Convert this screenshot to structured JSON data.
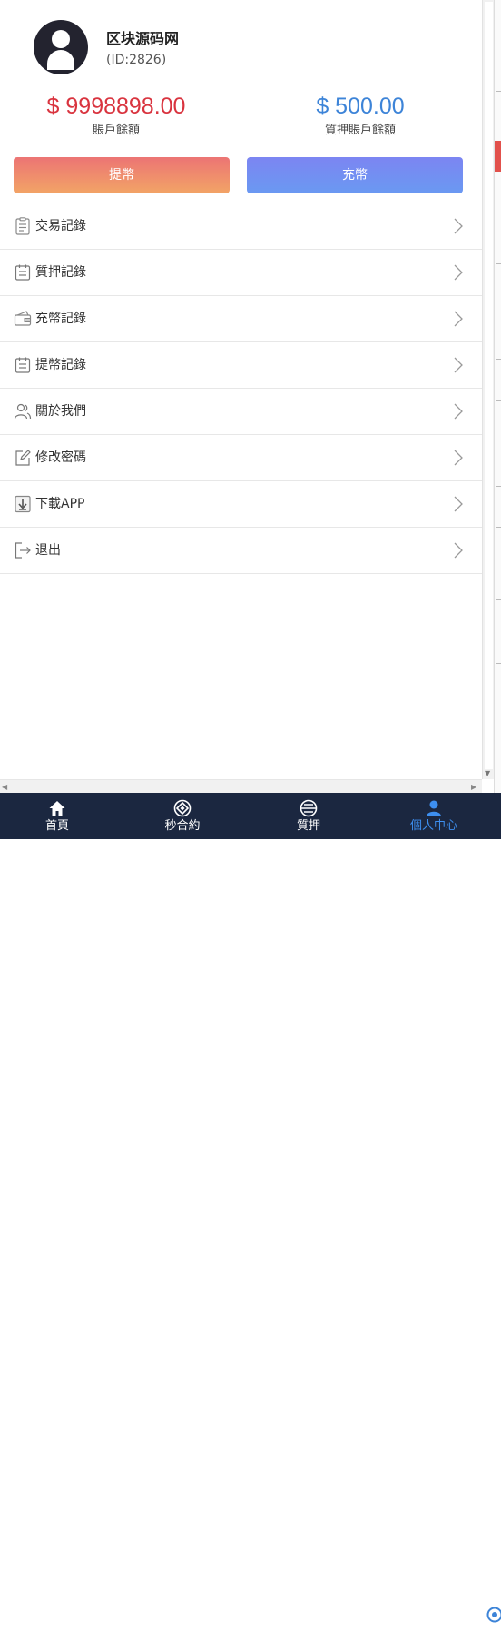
{
  "profile": {
    "username": "区块源码网",
    "user_id": "(ID:2826)"
  },
  "balances": {
    "main_amount": "$ 9998898.00",
    "main_label": "賬戶餘額",
    "pledge_amount": "$ 500.00",
    "pledge_label": "質押賬戶餘額"
  },
  "actions": {
    "withdraw_label": "提幣",
    "deposit_label": "充幣"
  },
  "menu": [
    {
      "label": "交易記錄",
      "icon": "document-list-icon"
    },
    {
      "label": "質押記錄",
      "icon": "clipboard-icon"
    },
    {
      "label": "充幣記錄",
      "icon": "wallet-icon"
    },
    {
      "label": "提幣記錄",
      "icon": "clipboard-icon"
    },
    {
      "label": "關於我們",
      "icon": "users-icon"
    },
    {
      "label": "修改密碼",
      "icon": "edit-icon"
    },
    {
      "label": "下載APP",
      "icon": "download-icon"
    },
    {
      "label": "退出",
      "icon": "logout-icon"
    }
  ],
  "tabbar": {
    "items": [
      {
        "label": "首頁",
        "icon": "home-icon"
      },
      {
        "label": "秒合約",
        "icon": "contract-icon"
      },
      {
        "label": "質押",
        "icon": "pledge-icon"
      },
      {
        "label": "個人中心",
        "icon": "user-icon"
      }
    ],
    "active_index": 3
  },
  "colors": {
    "main_balance": "#d9343f",
    "pledge_balance": "#3d84d8",
    "tabbar_bg": "#1b2740",
    "active_tab": "#3d8ff0"
  }
}
